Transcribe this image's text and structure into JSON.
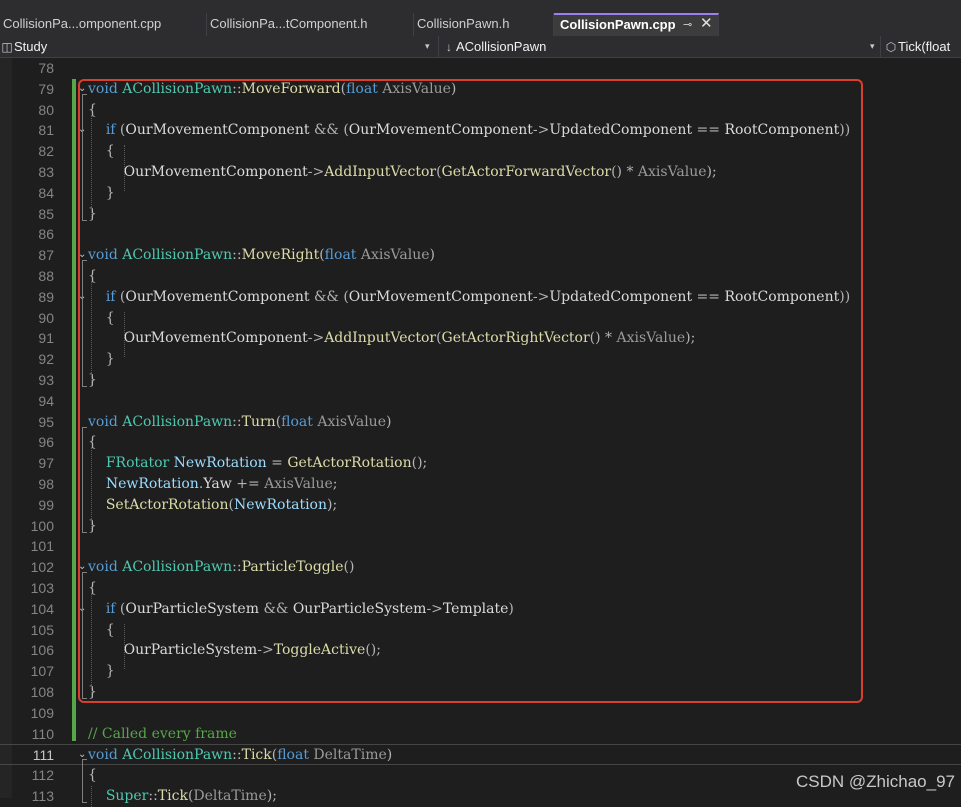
{
  "tabs": [
    {
      "label": "CollisionPa...omponent.cpp",
      "active": false
    },
    {
      "label": "CollisionPa...tComponent.h",
      "active": false
    },
    {
      "label": "CollisionPawn.h",
      "active": false
    },
    {
      "label": "CollisionPawn.cpp",
      "active": true,
      "pin_glyph": "⊸",
      "close_glyph": "✕"
    }
  ],
  "navbar": {
    "project": "Study",
    "scope": "ACollisionPawn",
    "member": "Tick(float",
    "dropdown_glyph": "▾"
  },
  "editor": {
    "current_line": 111,
    "lines": [
      {
        "n": 78,
        "t": []
      },
      {
        "n": 79,
        "t": [
          [
            "kw",
            "void "
          ],
          [
            "ty",
            "ACollisionPawn"
          ],
          [
            "pu",
            "::"
          ],
          [
            "fn",
            "MoveForward"
          ],
          [
            "pu",
            "("
          ],
          [
            "kw",
            "float "
          ],
          [
            "pm",
            "AxisValue"
          ],
          [
            "pu",
            ")"
          ]
        ]
      },
      {
        "n": 80,
        "t": [
          [
            "pu",
            "{"
          ]
        ]
      },
      {
        "n": 81,
        "t": [
          [
            "pu",
            "    "
          ],
          [
            "kw",
            "if "
          ],
          [
            "pu",
            "("
          ],
          [
            "mb",
            "OurMovementComponent"
          ],
          [
            "pu",
            " && ("
          ],
          [
            "mb",
            "OurMovementComponent"
          ],
          [
            "pu",
            "->"
          ],
          [
            "mb",
            "UpdatedComponent"
          ],
          [
            "pu",
            " == "
          ],
          [
            "mb",
            "RootComponent"
          ],
          [
            "pu",
            "))"
          ]
        ]
      },
      {
        "n": 82,
        "t": [
          [
            "pu",
            "    {"
          ]
        ]
      },
      {
        "n": 83,
        "t": [
          [
            "pu",
            "        "
          ],
          [
            "mb",
            "OurMovementComponent"
          ],
          [
            "pu",
            "->"
          ],
          [
            "fn",
            "AddInputVector"
          ],
          [
            "pu",
            "("
          ],
          [
            "fn",
            "GetActorForwardVector"
          ],
          [
            "pu",
            "() * "
          ],
          [
            "pm",
            "AxisValue"
          ],
          [
            "pu",
            ");"
          ]
        ]
      },
      {
        "n": 84,
        "t": [
          [
            "pu",
            "    }"
          ]
        ]
      },
      {
        "n": 85,
        "t": [
          [
            "pu",
            "}"
          ]
        ]
      },
      {
        "n": 86,
        "t": []
      },
      {
        "n": 87,
        "t": [
          [
            "kw",
            "void "
          ],
          [
            "ty",
            "ACollisionPawn"
          ],
          [
            "pu",
            "::"
          ],
          [
            "fn",
            "MoveRight"
          ],
          [
            "pu",
            "("
          ],
          [
            "kw",
            "float "
          ],
          [
            "pm",
            "AxisValue"
          ],
          [
            "pu",
            ")"
          ]
        ]
      },
      {
        "n": 88,
        "t": [
          [
            "pu",
            "{"
          ]
        ]
      },
      {
        "n": 89,
        "t": [
          [
            "pu",
            "    "
          ],
          [
            "kw",
            "if "
          ],
          [
            "pu",
            "("
          ],
          [
            "mb",
            "OurMovementComponent"
          ],
          [
            "pu",
            " && ("
          ],
          [
            "mb",
            "OurMovementComponent"
          ],
          [
            "pu",
            "->"
          ],
          [
            "mb",
            "UpdatedComponent"
          ],
          [
            "pu",
            " == "
          ],
          [
            "mb",
            "RootComponent"
          ],
          [
            "pu",
            "))"
          ]
        ]
      },
      {
        "n": 90,
        "t": [
          [
            "pu",
            "    {"
          ]
        ]
      },
      {
        "n": 91,
        "t": [
          [
            "pu",
            "        "
          ],
          [
            "mb",
            "OurMovementComponent"
          ],
          [
            "pu",
            "->"
          ],
          [
            "fn",
            "AddInputVector"
          ],
          [
            "pu",
            "("
          ],
          [
            "fn",
            "GetActorRightVector"
          ],
          [
            "pu",
            "() * "
          ],
          [
            "pm",
            "AxisValue"
          ],
          [
            "pu",
            ");"
          ]
        ]
      },
      {
        "n": 92,
        "t": [
          [
            "pu",
            "    }"
          ]
        ]
      },
      {
        "n": 93,
        "t": [
          [
            "pu",
            "}"
          ]
        ]
      },
      {
        "n": 94,
        "t": []
      },
      {
        "n": 95,
        "t": [
          [
            "kw",
            "void "
          ],
          [
            "ty",
            "ACollisionPawn"
          ],
          [
            "pu",
            "::"
          ],
          [
            "fn",
            "Turn"
          ],
          [
            "pu",
            "("
          ],
          [
            "kw",
            "float "
          ],
          [
            "pm",
            "AxisValue"
          ],
          [
            "pu",
            ")"
          ]
        ]
      },
      {
        "n": 96,
        "t": [
          [
            "pu",
            "{"
          ]
        ]
      },
      {
        "n": 97,
        "t": [
          [
            "pu",
            "    "
          ],
          [
            "ty",
            "FRotator "
          ],
          [
            "vr",
            "NewRotation"
          ],
          [
            "pu",
            " = "
          ],
          [
            "fn",
            "GetActorRotation"
          ],
          [
            "pu",
            "();"
          ]
        ]
      },
      {
        "n": 98,
        "t": [
          [
            "pu",
            "    "
          ],
          [
            "vr",
            "NewRotation"
          ],
          [
            "pu",
            "."
          ],
          [
            "mb",
            "Yaw"
          ],
          [
            "pu",
            " += "
          ],
          [
            "pm",
            "AxisValue"
          ],
          [
            "pu",
            ";"
          ]
        ]
      },
      {
        "n": 99,
        "t": [
          [
            "pu",
            "    "
          ],
          [
            "fn",
            "SetActorRotation"
          ],
          [
            "pu",
            "("
          ],
          [
            "vr",
            "NewRotation"
          ],
          [
            "pu",
            ");"
          ]
        ]
      },
      {
        "n": 100,
        "t": [
          [
            "pu",
            "}"
          ]
        ]
      },
      {
        "n": 101,
        "t": []
      },
      {
        "n": 102,
        "t": [
          [
            "kw",
            "void "
          ],
          [
            "ty",
            "ACollisionPawn"
          ],
          [
            "pu",
            "::"
          ],
          [
            "fn",
            "ParticleToggle"
          ],
          [
            "pu",
            "()"
          ]
        ]
      },
      {
        "n": 103,
        "t": [
          [
            "pu",
            "{"
          ]
        ]
      },
      {
        "n": 104,
        "t": [
          [
            "pu",
            "    "
          ],
          [
            "kw",
            "if "
          ],
          [
            "pu",
            "("
          ],
          [
            "mb",
            "OurParticleSystem"
          ],
          [
            "pu",
            " && "
          ],
          [
            "mb",
            "OurParticleSystem"
          ],
          [
            "pu",
            "->"
          ],
          [
            "mb",
            "Template"
          ],
          [
            "pu",
            ")"
          ]
        ]
      },
      {
        "n": 105,
        "t": [
          [
            "pu",
            "    {"
          ]
        ]
      },
      {
        "n": 106,
        "t": [
          [
            "pu",
            "        "
          ],
          [
            "mb",
            "OurParticleSystem"
          ],
          [
            "pu",
            "->"
          ],
          [
            "fn",
            "ToggleActive"
          ],
          [
            "pu",
            "();"
          ]
        ]
      },
      {
        "n": 107,
        "t": [
          [
            "pu",
            "    }"
          ]
        ]
      },
      {
        "n": 108,
        "t": [
          [
            "pu",
            "}"
          ]
        ]
      },
      {
        "n": 109,
        "t": []
      },
      {
        "n": 110,
        "t": [
          [
            "cm",
            "// Called every frame"
          ]
        ]
      },
      {
        "n": 111,
        "t": [
          [
            "kw",
            "void "
          ],
          [
            "ty",
            "ACollisionPawn"
          ],
          [
            "pu",
            "::"
          ],
          [
            "fn",
            "Tick"
          ],
          [
            "pu",
            "("
          ],
          [
            "kw",
            "float "
          ],
          [
            "pm",
            "DeltaTime"
          ],
          [
            "pu",
            ")"
          ]
        ]
      },
      {
        "n": 112,
        "t": [
          [
            "pu",
            "{"
          ]
        ]
      },
      {
        "n": 113,
        "t": [
          [
            "pu",
            "    "
          ],
          [
            "ty",
            "Super"
          ],
          [
            "pu",
            "::"
          ],
          [
            "fn",
            "Tick"
          ],
          [
            "pu",
            "("
          ],
          [
            "pm",
            "DeltaTime"
          ],
          [
            "pu",
            ");"
          ]
        ]
      }
    ],
    "fold_markers": [
      79,
      81,
      87,
      89,
      102,
      104,
      111
    ],
    "fold_glyph": "⌄"
  },
  "watermark": "CSDN @Zhichao_97",
  "colors": {
    "highlight_box": "#d9402c",
    "change_bar": "#57a64a",
    "active_tab_accent": "#9c7ef0",
    "keyword": "#569cd6",
    "type": "#4ec9b0",
    "function": "#dcdcaa",
    "comment": "#57a64a"
  }
}
